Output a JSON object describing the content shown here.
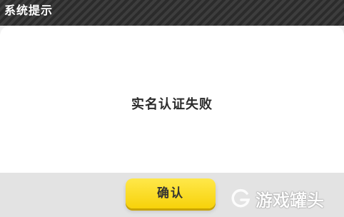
{
  "dialog": {
    "title": "系统提示",
    "message": "实名认证失败",
    "confirm_label": "确认"
  },
  "watermark": {
    "text": "游戏罐头",
    "icon": "g-logo-icon"
  },
  "colors": {
    "title_bar": "#333333",
    "button": "#f7d20a",
    "footer": "#e3e3e3"
  }
}
